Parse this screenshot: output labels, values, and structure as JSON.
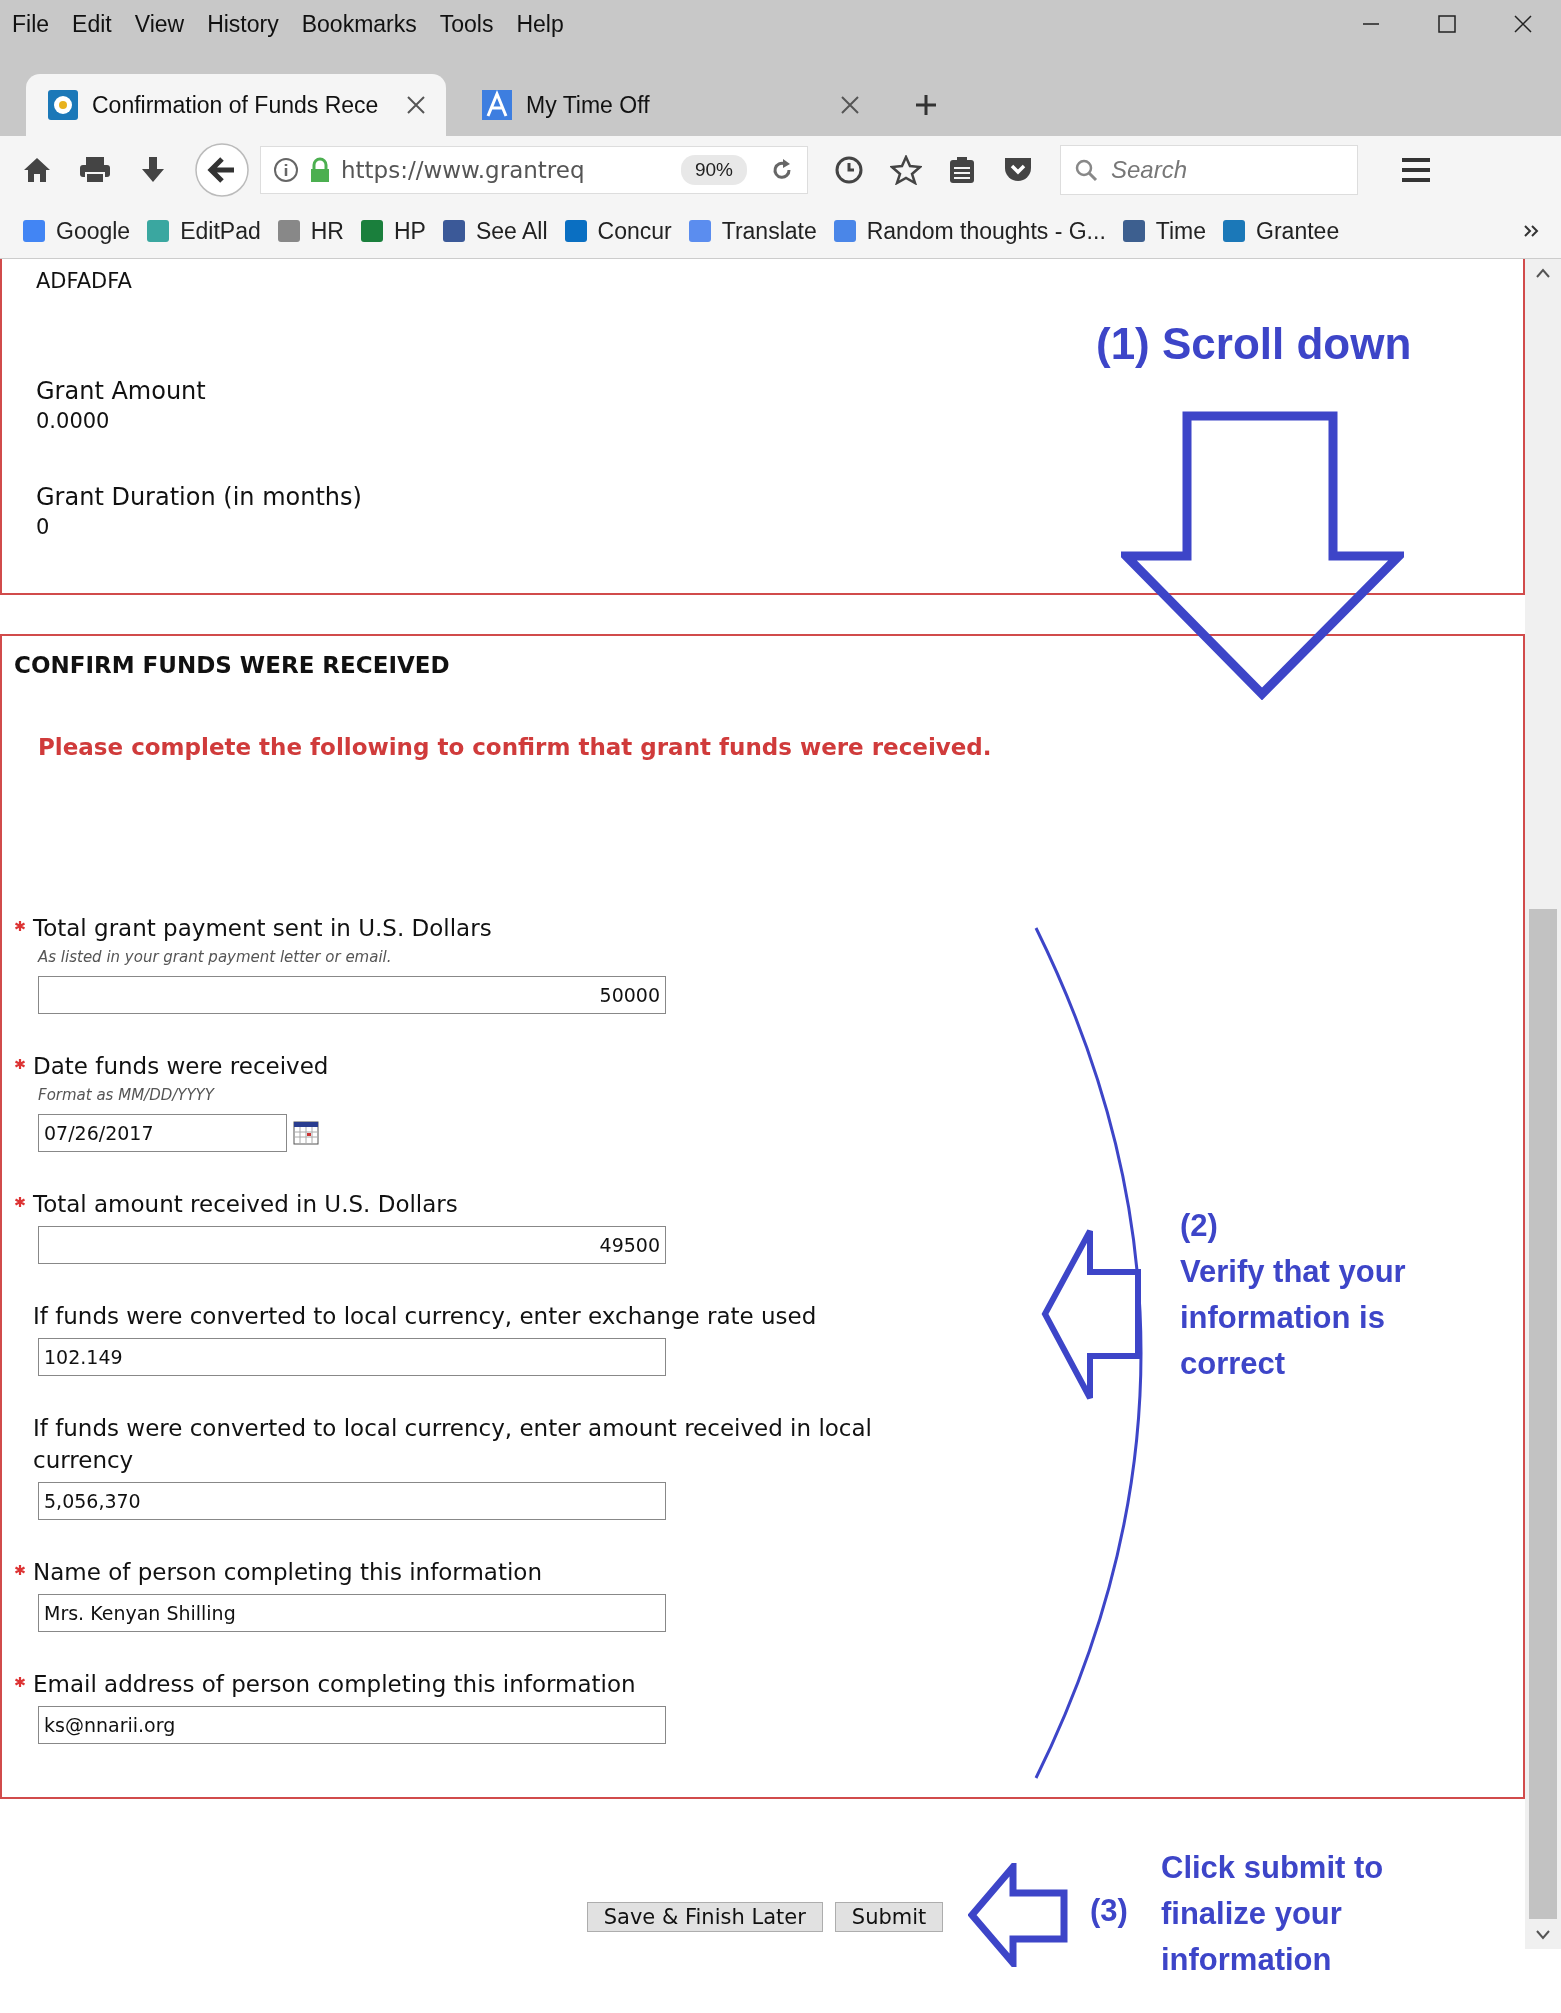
{
  "menu": [
    "File",
    "Edit",
    "View",
    "History",
    "Bookmarks",
    "Tools",
    "Help"
  ],
  "tabs": [
    {
      "title": "Confirmation of Funds Rece",
      "selected": true
    },
    {
      "title": "My Time Off",
      "selected": false
    }
  ],
  "toolbar": {
    "url": "https://www.grantreq",
    "zoom": "90%",
    "search": {
      "placeholder": "Search"
    }
  },
  "bookmarks": [
    "Google",
    "EditPad",
    "HR",
    "HP",
    "See All",
    "Concur",
    "Translate",
    "Random thoughts - G...",
    "Time",
    "Grantee"
  ],
  "details": [
    {
      "value": "ADFADFA"
    },
    {
      "label": "Grant Amount",
      "value": "0.0000"
    },
    {
      "label": "Grant Duration (in months)",
      "value": "0"
    }
  ],
  "section": {
    "title": "CONFIRM FUNDS WERE RECEIVED",
    "instruction": "Please complete the following to confirm that grant funds were received.",
    "fields": [
      {
        "label": "Total grant payment sent in U.S. Dollars",
        "hint": "As listed in your grant payment letter or email.",
        "value": "50000",
        "required": true,
        "kind": "number"
      },
      {
        "label": "Date funds were received",
        "hint": "Format as MM/DD/YYYY",
        "value": "07/26/2017",
        "required": true,
        "kind": "date"
      },
      {
        "label": "Total amount received in U.S. Dollars",
        "value": "49500",
        "required": true,
        "kind": "number"
      },
      {
        "label": "If funds were converted to local currency, enter exchange rate used",
        "value": "102.149",
        "required": false,
        "kind": "text"
      },
      {
        "label": "If funds were converted to local currency, enter amount received in local currency",
        "value": "5,056,370",
        "required": false,
        "kind": "text"
      },
      {
        "label": "Name of person completing this information",
        "value": "Mrs. Kenyan Shilling",
        "required": true,
        "kind": "text"
      },
      {
        "label": "Email address of person completing this information",
        "value": "ks@nnarii.org",
        "required": true,
        "kind": "text"
      }
    ]
  },
  "buttons": [
    "Save & Finish Later",
    "Submit"
  ],
  "annotations": [
    {
      "kind": "scroll",
      "text": "(1) Scroll down"
    },
    {
      "kind": "verify",
      "number": "(2)",
      "text": "Verify that your information is correct"
    },
    {
      "kind": "submit",
      "number": "(3)",
      "text": "Click submit to finalize your information"
    }
  ]
}
